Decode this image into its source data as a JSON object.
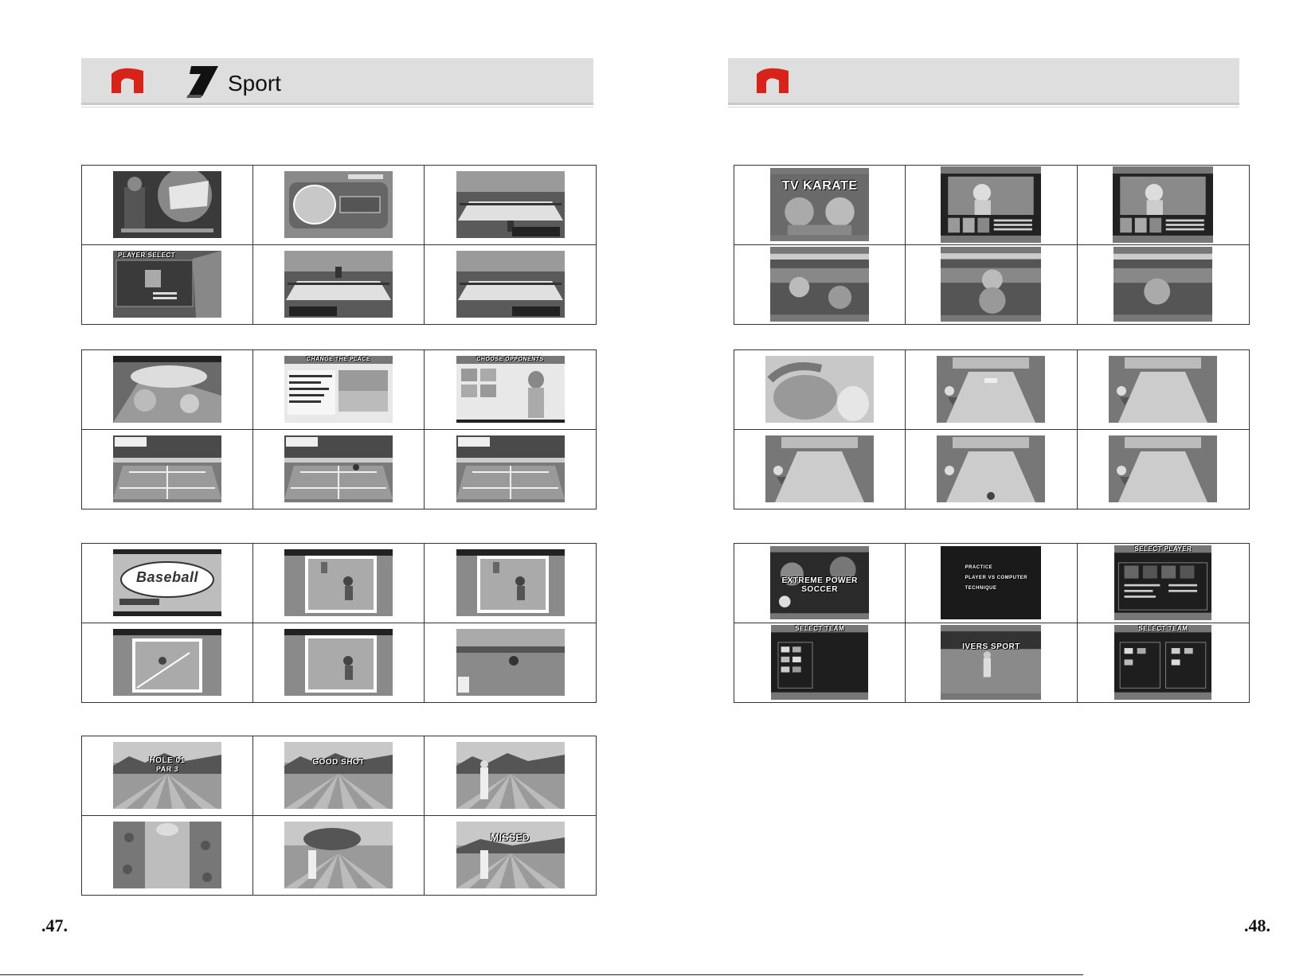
{
  "left_page": {
    "header": {
      "title": "Sport",
      "section_number": "7"
    },
    "page_number": ".47."
  },
  "right_page": {
    "header": {
      "title": ""
    },
    "page_number": ".48."
  },
  "thumbnail_text": {
    "karate_title": "TV KARATE",
    "soccer_title": "EXTREME POWER SOCCER",
    "soccer_menu": [
      "PRACTICE",
      "PLAYER VS COMPUTER",
      "TECHNIQUE"
    ],
    "select_player": "SELECT PLAYER",
    "select_team": "SELECT TEAM",
    "banner": "IVERS SPORT",
    "baseball_title": "Baseball",
    "tennis_place": "CHANGE THE PLACE",
    "tennis_opponents": "CHOOSE OPPONENTS",
    "pingpong_select": "PLAYER SELECT",
    "golf_hole": "HOLE 01",
    "golf_par": "PAR 3",
    "golf_good_shot": "GOOD SHOT",
    "golf_missed": "MISSED"
  },
  "colors": {
    "header_bg": "#dedede",
    "logo_red": "#d8231b",
    "rule": "#333333"
  }
}
